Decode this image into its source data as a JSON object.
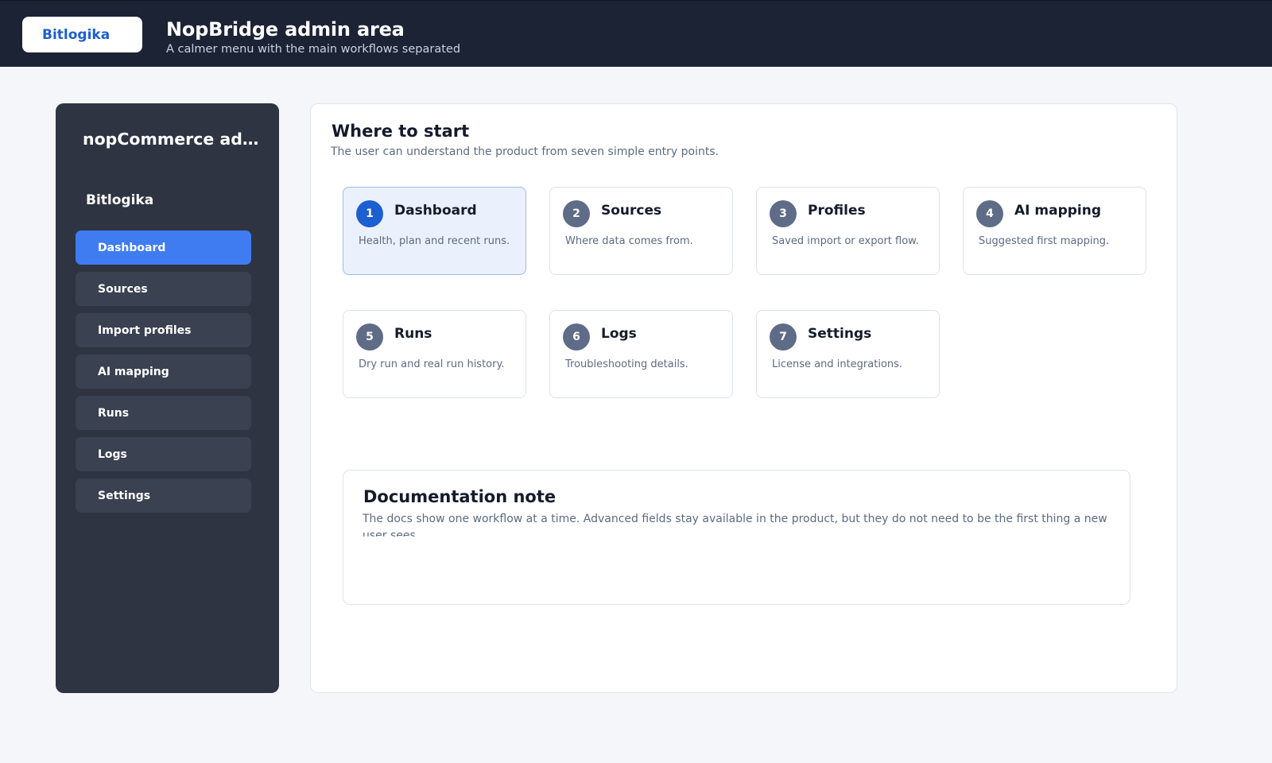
{
  "header": {
    "brand_button": "Bitlogika",
    "title": "NopBridge admin area",
    "subtitle": "A calmer menu with the main workflows separated"
  },
  "sidebar": {
    "title": "nopCommerce admin",
    "brand": "Bitlogika",
    "items": [
      {
        "label": "Dashboard",
        "active": true
      },
      {
        "label": "Sources"
      },
      {
        "label": "Import profiles"
      },
      {
        "label": "AI mapping"
      },
      {
        "label": "Runs"
      },
      {
        "label": "Logs"
      },
      {
        "label": "Settings"
      }
    ]
  },
  "main": {
    "title": "Where to start",
    "subtitle": "The user can understand the product from seven simple entry points.",
    "cards": [
      {
        "num": "1",
        "title": "Dashboard",
        "desc": "Health, plan and recent runs."
      },
      {
        "num": "2",
        "title": "Sources",
        "desc": "Where data comes from."
      },
      {
        "num": "3",
        "title": "Profiles",
        "desc": "Saved import or export flow."
      },
      {
        "num": "4",
        "title": "AI mapping",
        "desc": "Suggested first mapping."
      },
      {
        "num": "5",
        "title": "Runs",
        "desc": "Dry run and real run history."
      },
      {
        "num": "6",
        "title": "Logs",
        "desc": "Troubleshooting details."
      },
      {
        "num": "7",
        "title": "Settings",
        "desc": "License and integrations."
      }
    ],
    "doc_note": {
      "title": "Documentation note",
      "text": "The docs show one workflow at a time. Advanced fields stay available in the product, but they do not need to be the first thing a new user sees."
    }
  },
  "colors": {
    "topbar": "#1c2335",
    "sidebar": "#2e3442",
    "nav_active": "#3f7cf2",
    "accent": "#1c5fd1",
    "card_active_bg": "#eaf1fd"
  }
}
